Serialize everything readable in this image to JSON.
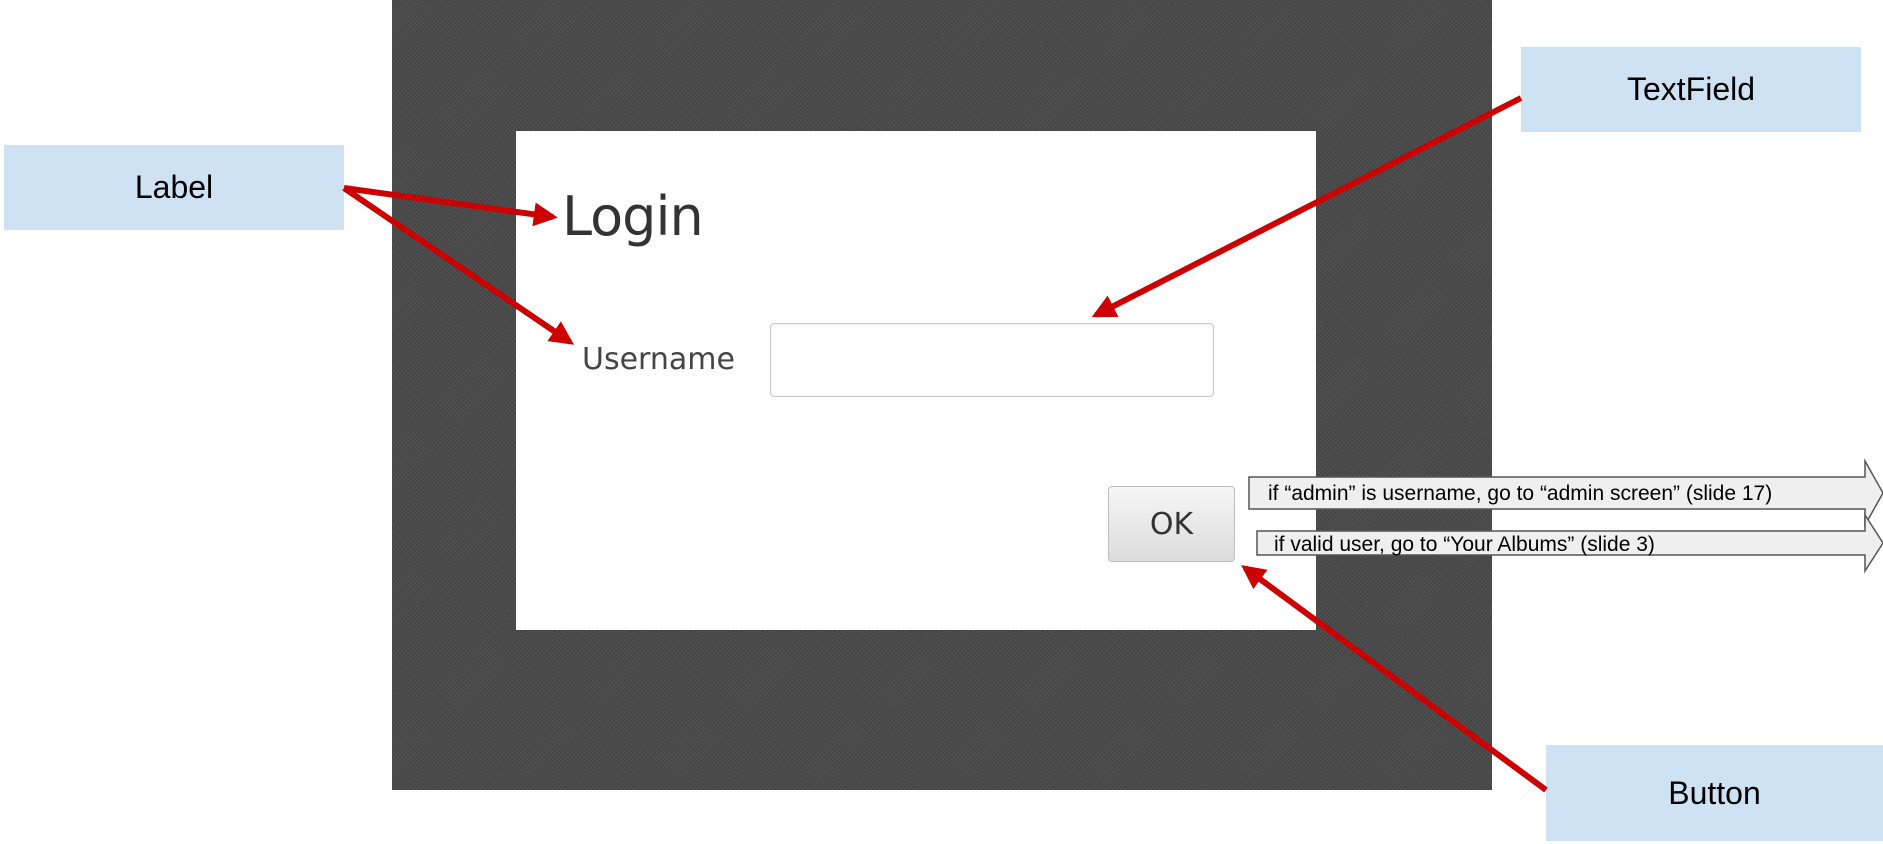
{
  "screen": {
    "title": "Login",
    "username_label": "Username",
    "username_value": "",
    "ok_label": "OK"
  },
  "callouts": {
    "label": "Label",
    "textfield": "TextField",
    "button": "Button"
  },
  "flows": [
    {
      "text": "if “admin” is username, go to “admin screen” (slide 17)"
    },
    {
      "text": "if valid user, go to “Your Albums” (slide 3)"
    }
  ],
  "colors": {
    "frame_bg": "#4a4a4a",
    "panel_bg": "#ffffff",
    "callout_bg": "#cfe2f3",
    "arrow": "#cc0000",
    "flow_arrow_fill": "#efefef",
    "flow_arrow_stroke": "#555555"
  }
}
